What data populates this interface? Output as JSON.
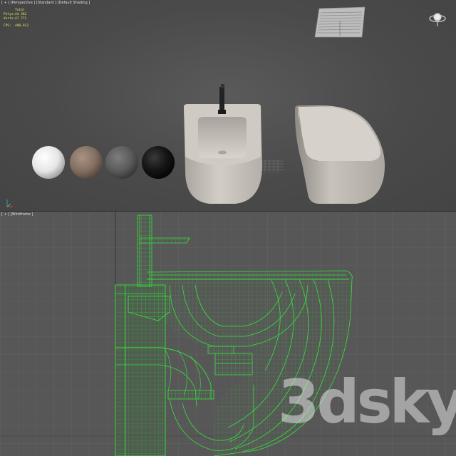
{
  "top_viewport": {
    "label": "[ + ] [Perspective ] [Standard ] [Default Shading ]",
    "stats": {
      "header": "Total",
      "polys_label": "Polys:",
      "polys_value": "44 362",
      "verts_label": "Verts:",
      "verts_value": "47 771",
      "fps_label": "FPS:",
      "fps_value": "408,913"
    },
    "material_sphere_colors": [
      "#f2f2f2",
      "#8a7668",
      "#5c5c5c",
      "#141414"
    ],
    "ceramic_color": "#c9c4bd"
  },
  "bottom_viewport": {
    "label": "[ + ] [Wireframe ]",
    "wire_color": "#33e03a"
  },
  "watermark": "3dsky",
  "icons": [
    "navigation-cube-icon",
    "axis-gizmo-icon"
  ]
}
